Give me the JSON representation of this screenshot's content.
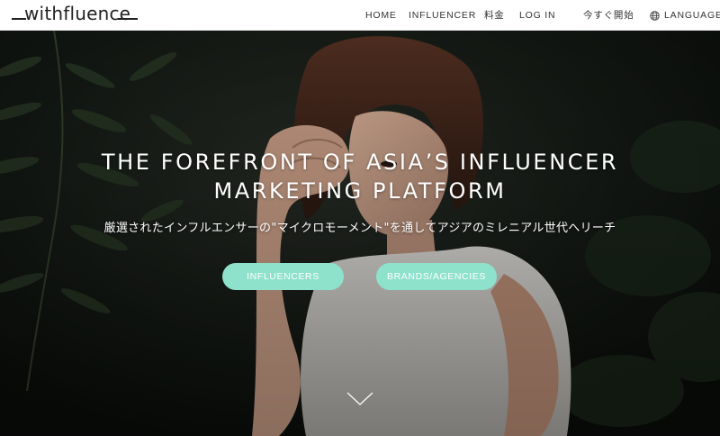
{
  "header": {
    "logo_text": "withfluence",
    "nav": {
      "home": "HOME",
      "influencer": "INFLUENCER",
      "pricing": "料金",
      "login": "LOG IN",
      "start_now": "今すぐ開始",
      "language": "LANGUAGE"
    }
  },
  "hero": {
    "headline_line1": "THE FOREFRONT OF ASIA’S INFLUENCER",
    "headline_line2": "MARKETING PLATFORM",
    "subheadline": "厳選されたインフルエンサーの\"マイクロモーメント\"を通してアジアのミレニアル世代へリーチ",
    "buttons": {
      "influencers": "INFLUENCERS",
      "brands": "BRANDS/AGENCIES"
    }
  },
  "colors": {
    "accent": "#8ee2cb",
    "header_bg": "#ffffff",
    "text_dark": "#333333",
    "hero_text": "#ffffff"
  },
  "icons": [
    "globe-icon",
    "chevron-down-icon"
  ]
}
